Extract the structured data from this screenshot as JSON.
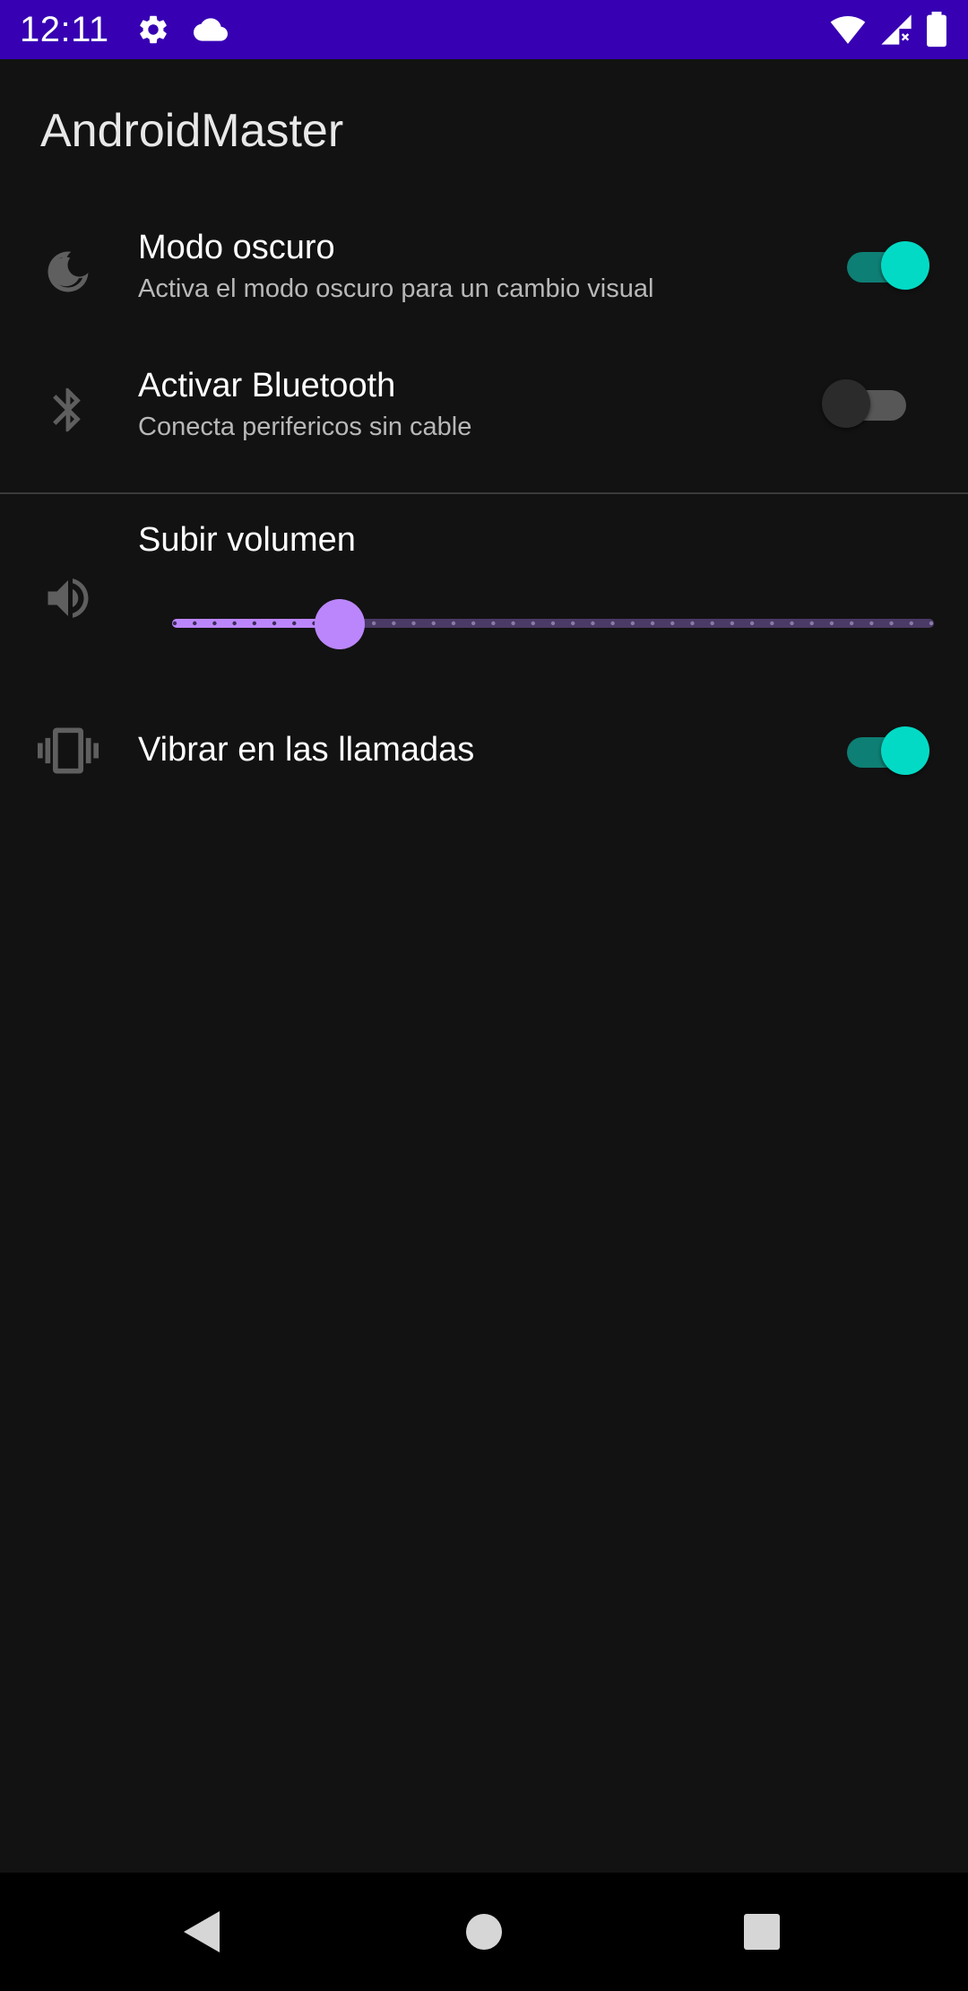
{
  "status_bar": {
    "time": "12:11",
    "left_icons": [
      "settings-icon",
      "cloud-icon"
    ],
    "right_icons": [
      "wifi-icon",
      "signal-no-data-icon",
      "battery-icon"
    ],
    "background_color": "#3700b3"
  },
  "toolbar": {
    "title": "AndroidMaster"
  },
  "preferences": {
    "dark_mode": {
      "icon": "moon-icon",
      "title": "Modo oscuro",
      "summary": "Activa el modo oscuro para un cambio visual",
      "enabled": true
    },
    "bluetooth": {
      "icon": "bluetooth-icon",
      "title": "Activar Bluetooth",
      "summary": "Conecta perifericos sin cable",
      "enabled": false
    },
    "volume": {
      "icon": "volume-up-icon",
      "title": "Subir volumen",
      "value_fraction": 0.22,
      "tick_count": 38
    },
    "vibrate": {
      "icon": "vibration-icon",
      "title": "Vibrar en las llamadas",
      "enabled": true
    }
  },
  "colors": {
    "background": "#121212",
    "switch_thumb_on": "#03dac5",
    "switch_track_on": "#0e7f74",
    "slider_accent": "#bb86fc"
  },
  "nav_bar": {
    "buttons": [
      "back-icon",
      "home-icon",
      "recents-icon"
    ]
  }
}
